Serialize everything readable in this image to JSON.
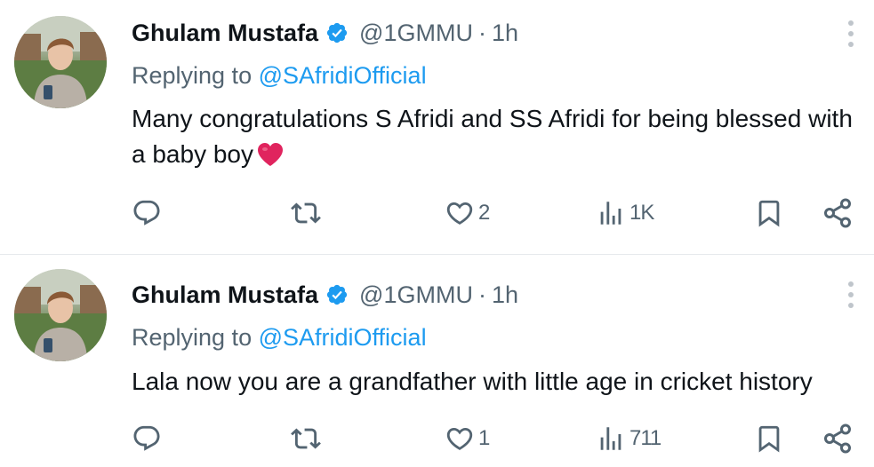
{
  "tweets": [
    {
      "author_name": "Ghulam Mustafa",
      "handle": "@1GMMU",
      "separator": "·",
      "time": "1h",
      "replying_prefix": "Replying to",
      "replying_to": "@SAfridiOfficial",
      "text": "Many congratulations S Afridi and SS Afridi for being blessed with a baby boy",
      "emoji": "red-heart",
      "actions": {
        "reply_count": "",
        "retweet_count": "",
        "like_count": "2",
        "views_count": "1K"
      }
    },
    {
      "author_name": "Ghulam Mustafa",
      "handle": "@1GMMU",
      "separator": "·",
      "time": "1h",
      "replying_prefix": "Replying to",
      "replying_to": "@SAfridiOfficial",
      "text": "Lala now you are a grandfather with little age in cricket history",
      "actions": {
        "reply_count": "",
        "retweet_count": "",
        "like_count": "1",
        "views_count": "711"
      }
    }
  ],
  "icons": [
    "reply-icon",
    "retweet-icon",
    "like-icon",
    "views-icon",
    "bookmark-icon",
    "share-icon",
    "more-options-icon",
    "verified-badge-icon"
  ],
  "colors": {
    "text_primary": "#0f1419",
    "text_secondary": "#536471",
    "link_blue": "#1d9bf0",
    "verified_blue": "#1d9bf0",
    "heart_red": "#e0245e",
    "divider": "#e6e9ec"
  }
}
